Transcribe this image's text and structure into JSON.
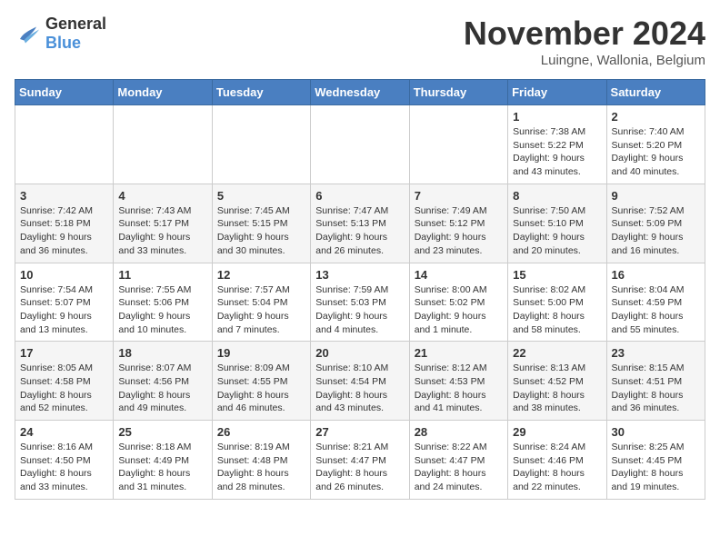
{
  "header": {
    "logo_general": "General",
    "logo_blue": "Blue",
    "month_title": "November 2024",
    "location": "Luingne, Wallonia, Belgium"
  },
  "weekdays": [
    "Sunday",
    "Monday",
    "Tuesday",
    "Wednesday",
    "Thursday",
    "Friday",
    "Saturday"
  ],
  "weeks": [
    [
      {
        "day": "",
        "info": ""
      },
      {
        "day": "",
        "info": ""
      },
      {
        "day": "",
        "info": ""
      },
      {
        "day": "",
        "info": ""
      },
      {
        "day": "",
        "info": ""
      },
      {
        "day": "1",
        "info": "Sunrise: 7:38 AM\nSunset: 5:22 PM\nDaylight: 9 hours and 43 minutes."
      },
      {
        "day": "2",
        "info": "Sunrise: 7:40 AM\nSunset: 5:20 PM\nDaylight: 9 hours and 40 minutes."
      }
    ],
    [
      {
        "day": "3",
        "info": "Sunrise: 7:42 AM\nSunset: 5:18 PM\nDaylight: 9 hours and 36 minutes."
      },
      {
        "day": "4",
        "info": "Sunrise: 7:43 AM\nSunset: 5:17 PM\nDaylight: 9 hours and 33 minutes."
      },
      {
        "day": "5",
        "info": "Sunrise: 7:45 AM\nSunset: 5:15 PM\nDaylight: 9 hours and 30 minutes."
      },
      {
        "day": "6",
        "info": "Sunrise: 7:47 AM\nSunset: 5:13 PM\nDaylight: 9 hours and 26 minutes."
      },
      {
        "day": "7",
        "info": "Sunrise: 7:49 AM\nSunset: 5:12 PM\nDaylight: 9 hours and 23 minutes."
      },
      {
        "day": "8",
        "info": "Sunrise: 7:50 AM\nSunset: 5:10 PM\nDaylight: 9 hours and 20 minutes."
      },
      {
        "day": "9",
        "info": "Sunrise: 7:52 AM\nSunset: 5:09 PM\nDaylight: 9 hours and 16 minutes."
      }
    ],
    [
      {
        "day": "10",
        "info": "Sunrise: 7:54 AM\nSunset: 5:07 PM\nDaylight: 9 hours and 13 minutes."
      },
      {
        "day": "11",
        "info": "Sunrise: 7:55 AM\nSunset: 5:06 PM\nDaylight: 9 hours and 10 minutes."
      },
      {
        "day": "12",
        "info": "Sunrise: 7:57 AM\nSunset: 5:04 PM\nDaylight: 9 hours and 7 minutes."
      },
      {
        "day": "13",
        "info": "Sunrise: 7:59 AM\nSunset: 5:03 PM\nDaylight: 9 hours and 4 minutes."
      },
      {
        "day": "14",
        "info": "Sunrise: 8:00 AM\nSunset: 5:02 PM\nDaylight: 9 hours and 1 minute."
      },
      {
        "day": "15",
        "info": "Sunrise: 8:02 AM\nSunset: 5:00 PM\nDaylight: 8 hours and 58 minutes."
      },
      {
        "day": "16",
        "info": "Sunrise: 8:04 AM\nSunset: 4:59 PM\nDaylight: 8 hours and 55 minutes."
      }
    ],
    [
      {
        "day": "17",
        "info": "Sunrise: 8:05 AM\nSunset: 4:58 PM\nDaylight: 8 hours and 52 minutes."
      },
      {
        "day": "18",
        "info": "Sunrise: 8:07 AM\nSunset: 4:56 PM\nDaylight: 8 hours and 49 minutes."
      },
      {
        "day": "19",
        "info": "Sunrise: 8:09 AM\nSunset: 4:55 PM\nDaylight: 8 hours and 46 minutes."
      },
      {
        "day": "20",
        "info": "Sunrise: 8:10 AM\nSunset: 4:54 PM\nDaylight: 8 hours and 43 minutes."
      },
      {
        "day": "21",
        "info": "Sunrise: 8:12 AM\nSunset: 4:53 PM\nDaylight: 8 hours and 41 minutes."
      },
      {
        "day": "22",
        "info": "Sunrise: 8:13 AM\nSunset: 4:52 PM\nDaylight: 8 hours and 38 minutes."
      },
      {
        "day": "23",
        "info": "Sunrise: 8:15 AM\nSunset: 4:51 PM\nDaylight: 8 hours and 36 minutes."
      }
    ],
    [
      {
        "day": "24",
        "info": "Sunrise: 8:16 AM\nSunset: 4:50 PM\nDaylight: 8 hours and 33 minutes."
      },
      {
        "day": "25",
        "info": "Sunrise: 8:18 AM\nSunset: 4:49 PM\nDaylight: 8 hours and 31 minutes."
      },
      {
        "day": "26",
        "info": "Sunrise: 8:19 AM\nSunset: 4:48 PM\nDaylight: 8 hours and 28 minutes."
      },
      {
        "day": "27",
        "info": "Sunrise: 8:21 AM\nSunset: 4:47 PM\nDaylight: 8 hours and 26 minutes."
      },
      {
        "day": "28",
        "info": "Sunrise: 8:22 AM\nSunset: 4:47 PM\nDaylight: 8 hours and 24 minutes."
      },
      {
        "day": "29",
        "info": "Sunrise: 8:24 AM\nSunset: 4:46 PM\nDaylight: 8 hours and 22 minutes."
      },
      {
        "day": "30",
        "info": "Sunrise: 8:25 AM\nSunset: 4:45 PM\nDaylight: 8 hours and 19 minutes."
      }
    ]
  ]
}
